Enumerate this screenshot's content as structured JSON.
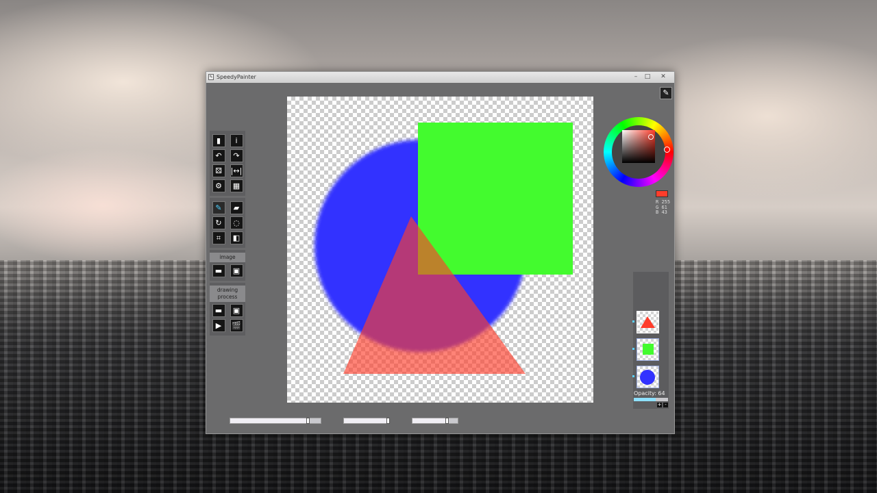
{
  "window": {
    "title": "SpeedyPainter",
    "controls": {
      "minimize": "–",
      "maximize": "□",
      "close": "✕"
    }
  },
  "toolbox": {
    "groups": [
      {
        "name": "file",
        "tools": [
          {
            "id": "new-document",
            "icon": "document-icon",
            "glyph": "▮"
          },
          {
            "id": "about",
            "icon": "info-icon",
            "glyph": "i"
          },
          {
            "id": "undo",
            "icon": "undo-icon",
            "glyph": "↶"
          },
          {
            "id": "redo",
            "icon": "redo-icon",
            "glyph": "↷"
          },
          {
            "id": "random",
            "icon": "dice-icon",
            "glyph": "⚄"
          },
          {
            "id": "canvas-size",
            "icon": "resize-icon",
            "glyph": "|↔|"
          },
          {
            "id": "settings",
            "icon": "gear-icon",
            "glyph": "⚙"
          },
          {
            "id": "reference",
            "icon": "gallery-icon",
            "glyph": "▦"
          }
        ]
      },
      {
        "name": "tools",
        "tools": [
          {
            "id": "brush",
            "icon": "brush-icon",
            "glyph": "✎",
            "active": true
          },
          {
            "id": "eraser",
            "icon": "eraser-icon",
            "glyph": "▰"
          },
          {
            "id": "rotate",
            "icon": "rotate-icon",
            "glyph": "↻"
          },
          {
            "id": "lasso",
            "icon": "lasso-icon",
            "glyph": "◌"
          },
          {
            "id": "crop",
            "icon": "crop-icon",
            "glyph": "⌗"
          },
          {
            "id": "mirror",
            "icon": "mirror-icon",
            "glyph": "◧"
          }
        ]
      }
    ],
    "image_label": "image",
    "image_tools": [
      {
        "id": "image-open",
        "icon": "folder-icon",
        "glyph": "▬"
      },
      {
        "id": "image-save",
        "icon": "save-icon",
        "glyph": "▣"
      }
    ],
    "process_label": "drawing process",
    "process_tools": [
      {
        "id": "process-open",
        "icon": "folder-icon",
        "glyph": "▬"
      },
      {
        "id": "process-save",
        "icon": "save-icon",
        "glyph": "▣"
      },
      {
        "id": "process-play",
        "icon": "play-icon",
        "glyph": "▶"
      },
      {
        "id": "process-record",
        "icon": "clapper-icon",
        "glyph": "🎬"
      }
    ]
  },
  "bottom_sliders": [
    {
      "id": "brush-size",
      "value": 0.85
    },
    {
      "id": "brush-opacity",
      "value": 0.95
    },
    {
      "id": "brush-hardness",
      "value": 0.75
    }
  ],
  "color": {
    "current_hex": "#ff3d2b",
    "r_label": "R",
    "r": "255",
    "g_label": "G",
    "g": "61",
    "b_label": "B",
    "b": "43"
  },
  "shapes": {
    "circle_color": "#3232ff",
    "square_color": "#43fb2e",
    "triangle_color": "#ff3d2b",
    "triangle_opacity": 0.64
  },
  "layers": {
    "items": [
      {
        "id": "layer-triangle",
        "thumb": "triangle",
        "color": "#ff3d2b",
        "selected": true
      },
      {
        "id": "layer-square",
        "thumb": "square",
        "color": "#43fb2e",
        "selected": false
      },
      {
        "id": "layer-circle",
        "thumb": "circle",
        "color": "#3232ff",
        "selected": false
      }
    ],
    "opacity_label": "Opacity: 64",
    "opacity_value": 0.64,
    "add_label": "+",
    "remove_label": "-"
  }
}
